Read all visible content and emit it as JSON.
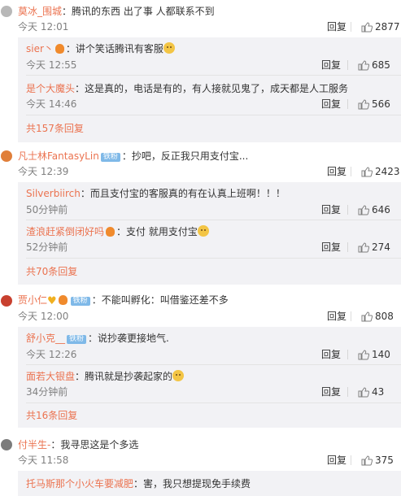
{
  "labels": {
    "reply": "回复"
  },
  "threads": [
    {
      "user": "莫冰_围城",
      "text": "：腾讯的东西 出了事 人都联系不到",
      "time": "今天 12:01",
      "likes": "2877",
      "replies": [
        {
          "user": "sier丶",
          "text": "：讲个笑话腾讯有客服",
          "time": "今天 12:55",
          "likes": "685"
        },
        {
          "user": "是个大魔头",
          "text": "：这是真的，电话是有的，有人接就见鬼了，成天都是人工服务",
          "time": "今天 14:46",
          "likes": "566"
        }
      ],
      "more": "共157条回复"
    },
    {
      "user": "凡士林FantasyLin",
      "badge": "铁粉",
      "text": "：抄吧，反正我只用支付宝...",
      "time": "今天 12:39",
      "likes": "2423",
      "replies": [
        {
          "user": "Silverbiirch",
          "text": "：而且支付宝的客服真的有在认真上班啊！！！",
          "time": "50分钟前",
          "likes": "646"
        },
        {
          "user": "渣浪赶紧倒闭好吗",
          "text": "：支付 就用支付宝",
          "time": "52分钟前",
          "likes": "274"
        }
      ],
      "more": "共70条回复"
    },
    {
      "user": "贾小仁",
      "badge": "铁粉",
      "text": "：不能叫孵化：叫借鉴还差不多",
      "time": "今天 12:00",
      "likes": "808",
      "replies": [
        {
          "user": "舒小克__",
          "badge": "铁粉",
          "text": "：说抄袭更接地气.",
          "time": "今天 12:26",
          "likes": "140"
        },
        {
          "user": "面若大银盘",
          "text": "：腾讯就是抄袭起家的",
          "time": "34分钟前",
          "likes": "43"
        }
      ],
      "more": "共16条回复"
    },
    {
      "user": "付半生-",
      "text": "：我寻思这是个多选",
      "time": "今天 11:58",
      "likes": "375",
      "replies": [
        {
          "user": "托马斯那个小火车要减肥",
          "text": "：害，我只想提现免手续费"
        }
      ]
    }
  ]
}
